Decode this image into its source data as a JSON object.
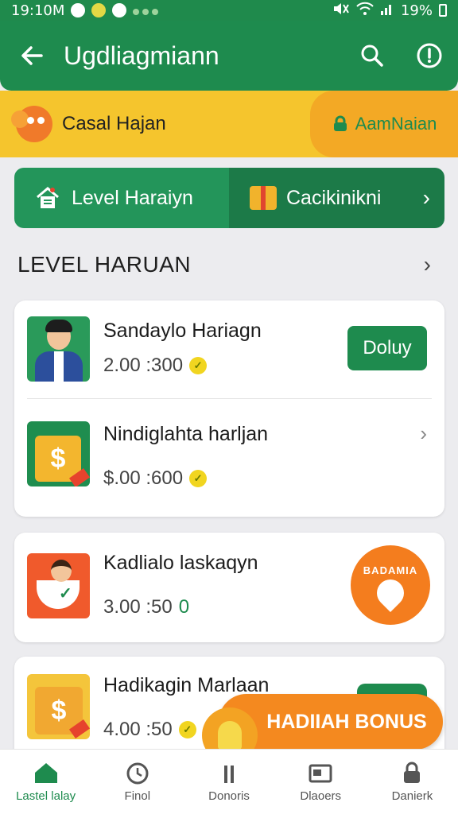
{
  "status_bar": {
    "time": "19:10M",
    "battery": "19%"
  },
  "app_bar": {
    "title": "Ugdliagmiann"
  },
  "banner": {
    "left_label": "Casal Hajan",
    "right_label": "AamNaian"
  },
  "tabs": [
    {
      "label": "Level Haraiyn",
      "icon": "house-icon"
    },
    {
      "label": "Cacikinikni",
      "icon": "gift-icon"
    }
  ],
  "section": {
    "title": "LEVEL HARUAN"
  },
  "items": [
    {
      "name": "Sandaylo Hariagn",
      "amount": "2.00 :300",
      "action": "Doluy"
    },
    {
      "name": "Nindiglahta harljan",
      "amount": "$.00 :600"
    },
    {
      "name": "Kadlialo laskaqyn",
      "amount": "3.00 :50",
      "badge_text": "BADAMIA"
    },
    {
      "name": "Hadikagin Marlaan",
      "amount": "4.00 :50"
    }
  ],
  "bonus_button": {
    "label": "HADIIAH BONUS"
  },
  "bottom_nav": [
    {
      "label": "Lastel lalay",
      "icon": "home-icon",
      "active": true
    },
    {
      "label": "Finol",
      "icon": "clock-icon",
      "active": false
    },
    {
      "label": "Donoris",
      "icon": "list-icon",
      "active": false
    },
    {
      "label": "Dlaoers",
      "icon": "wallet-icon",
      "active": false
    },
    {
      "label": "Danierk",
      "icon": "lock-icon",
      "active": false
    }
  ],
  "colors": {
    "primary_green": "#1e8b4e",
    "banner_yellow": "#f5c52d",
    "accent_orange": "#f47d1e"
  }
}
